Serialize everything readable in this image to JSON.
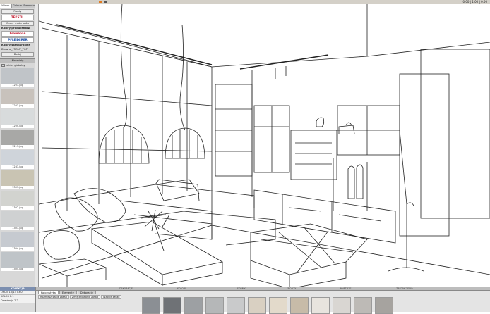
{
  "topbar": {
    "right_text": "0.00 | 1,00 | 0.00"
  },
  "left_panel": {
    "tabs": [
      "Widok",
      "Galeria",
      "Prezentacja"
    ],
    "buttons": [
      "Fronty",
      "Grupy materiałów"
    ],
    "producer_logos": [
      "TEKSTIL",
      "bromapan",
      "PFLEIDERER"
    ],
    "section_producer": "Kolory producentów",
    "section_standard": "Kolory standardowe",
    "standard_item": "Drewno_FRONT_TOP",
    "standard_sub": "Dodaj",
    "materials_header": "Materiały",
    "tree_item": "Lakier globalny",
    "swatches": [
      {
        "label": "1201.jpg",
        "color": "#c0c4c8"
      },
      {
        "label": "1203.jpg",
        "color": "#c8c2bc"
      },
      {
        "label": "1204.jpg",
        "color": "#d8dbdc"
      },
      {
        "label": "1211.jpg",
        "color": "#a8a8a6"
      },
      {
        "label": "1233.jpg",
        "color": "#cfd4da"
      },
      {
        "label": "1301.jpg",
        "color": "#c9c4b3"
      },
      {
        "label": "1302.jpg",
        "color": "#d2d3cf"
      },
      {
        "label": "1303.jpg",
        "color": "#cfd1d2"
      },
      {
        "label": "1304.jpg",
        "color": "#c6cad0"
      },
      {
        "label": "1305.jpg",
        "color": "#bfc4c8"
      }
    ]
  },
  "bottom": {
    "left_header": "KOLEKCJA",
    "left_rows": [
      "OPCJE 10/13 03.0",
      "KOLOR 2.1",
      "Orientacja 2.2"
    ],
    "strip_labels": [
      "DEKORACJE",
      "KOLORY",
      "FORMY",
      "FRONTY",
      "WNĘTRZE",
      "ZAKOŃCZENIA"
    ],
    "tabs": [
      "Kolorystyka",
      "Elementy",
      "Dekoracje"
    ],
    "subtabs": [
      "Rozmieszczanie zasad",
      "Zmiętanowanie zasad",
      "Wzorce zasad"
    ],
    "thumbs": [
      "#8b8f94",
      "#6f7276",
      "#9da0a3",
      "#b5b7b8",
      "#c9cacb",
      "#d9d0c2",
      "#e3dacb",
      "#c7bba8",
      "#e8e4de",
      "#d9d6d2",
      "#bdbab6",
      "#a6a39f"
    ]
  }
}
